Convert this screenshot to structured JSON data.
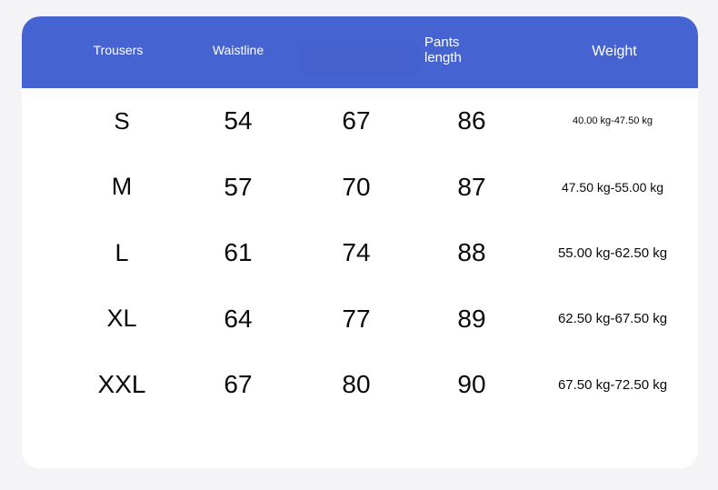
{
  "card": {
    "background_color": "#ffffff",
    "page_background_color": "#f4f4f6",
    "header_color": "#4663d2"
  },
  "table": {
    "headers": [
      {
        "label": "Trousers"
      },
      {
        "label": "Waistline"
      },
      {
        "label": ""
      },
      {
        "label": "Pants\nlength"
      },
      {
        "label": "Weight"
      }
    ],
    "rows": [
      {
        "size": "S",
        "waistline": "54",
        "hip": "67",
        "pants_length": "86",
        "weight": "40.00 kg-47.50 kg"
      },
      {
        "size": "M",
        "waistline": "57",
        "hip": "70",
        "pants_length": "87",
        "weight": "47.50 kg-55.00 kg"
      },
      {
        "size": "L",
        "waistline": "61",
        "hip": "74",
        "pants_length": "88",
        "weight": "55.00 kg-62.50 kg"
      },
      {
        "size": "XL",
        "waistline": "64",
        "hip": "77",
        "pants_length": "89",
        "weight": "62.50 kg-67.50 kg"
      },
      {
        "size": "XXL",
        "waistline": "67",
        "hip": "80",
        "pants_length": "90",
        "weight": "67.50 kg-72.50 kg"
      }
    ]
  }
}
